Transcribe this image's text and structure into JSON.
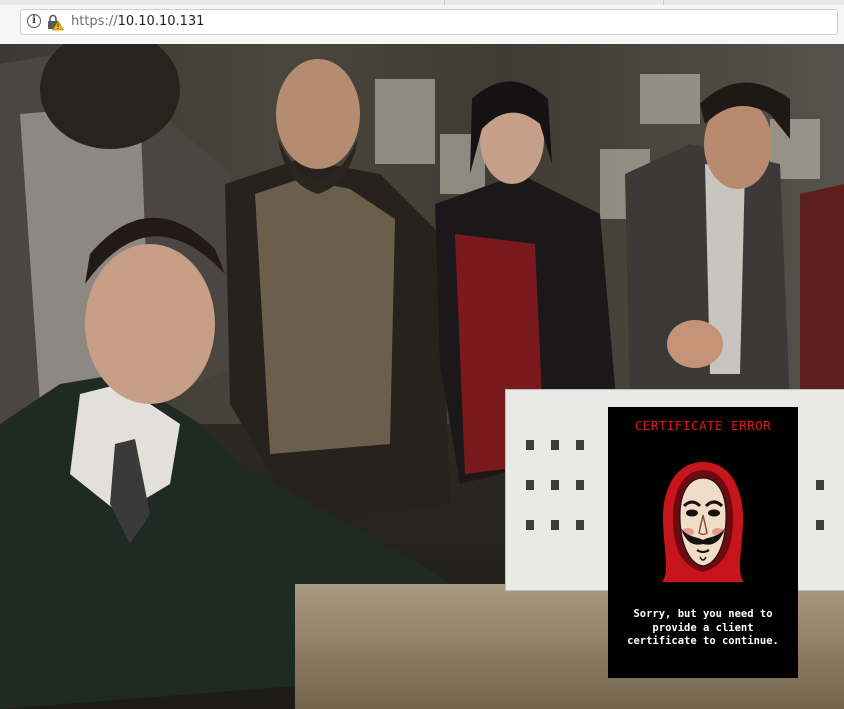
{
  "browser": {
    "url_scheme": "https://",
    "url_host": "10.10.10.131",
    "info_icon": "info-icon",
    "lock_icon": "insecure-lock-warning-icon"
  },
  "page": {
    "background_image": "group-photo",
    "certificate_error": {
      "title": "CERTIFICATE ERROR",
      "image": "dali-mask-red-hood",
      "message": "Sorry, but you need to provide a client certificate to continue.",
      "colors": {
        "title": "#e01919",
        "panel": "#000000",
        "message": "#ffffff"
      }
    }
  }
}
